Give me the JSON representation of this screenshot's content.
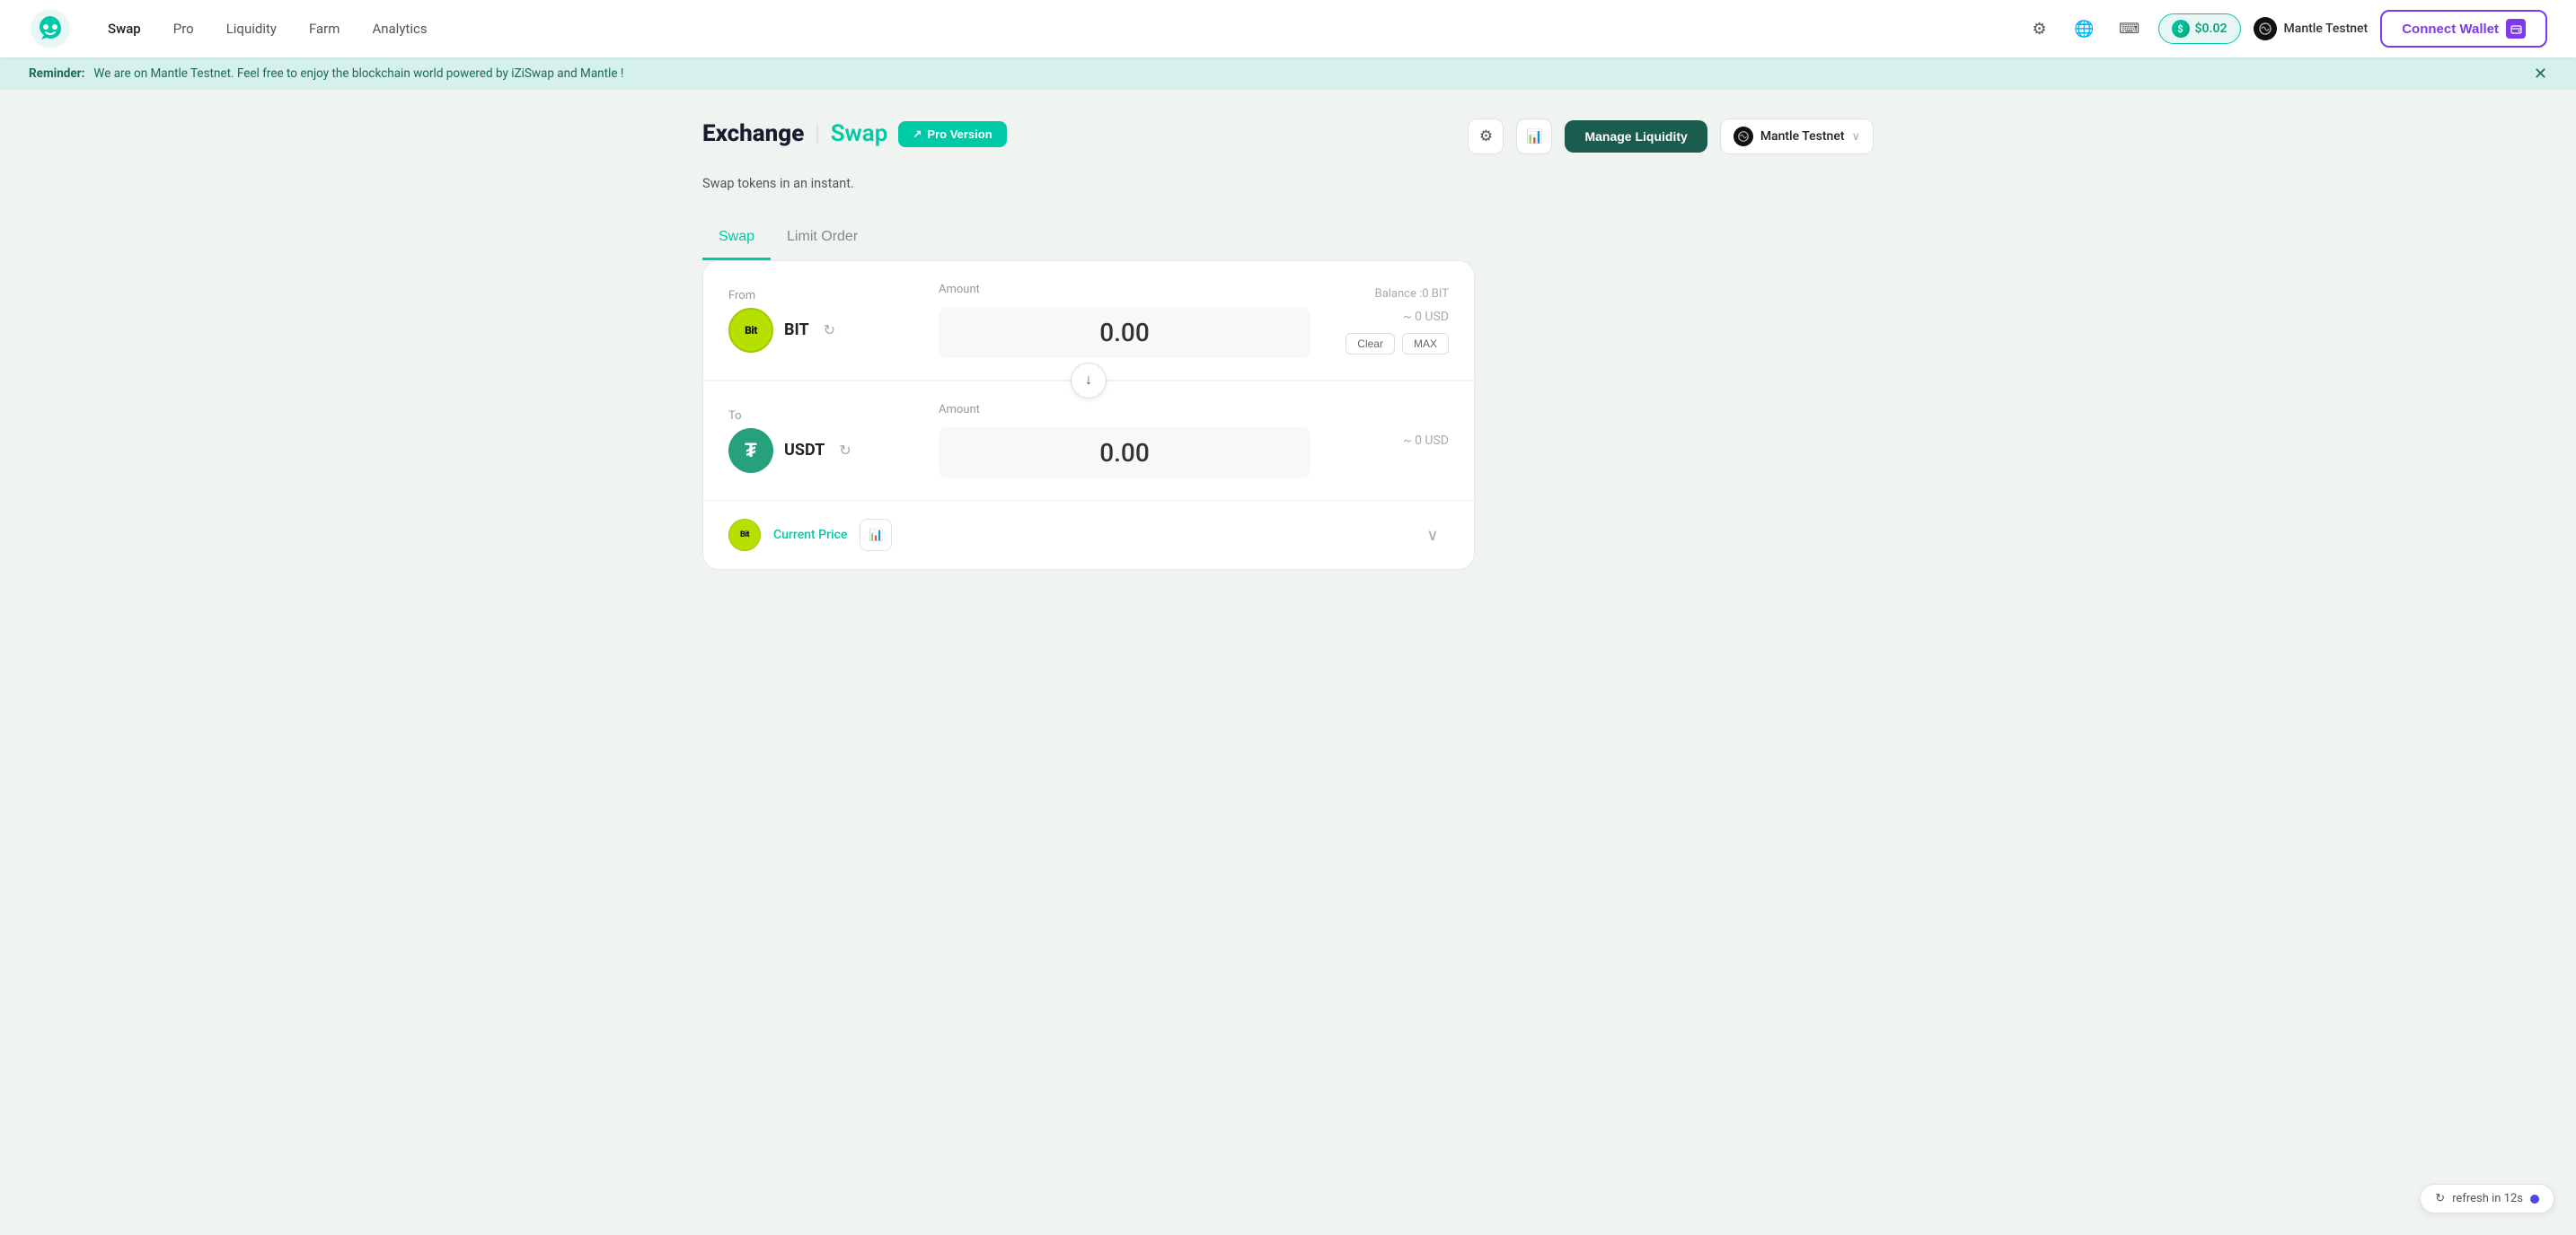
{
  "app": {
    "logo_alt": "iZiSwap Logo"
  },
  "nav": {
    "links": [
      {
        "id": "swap",
        "label": "Swap",
        "active": true
      },
      {
        "id": "pro",
        "label": "Pro",
        "active": false
      },
      {
        "id": "liquidity",
        "label": "Liquidity",
        "active": false
      },
      {
        "id": "farm",
        "label": "Farm",
        "active": false
      },
      {
        "id": "analytics",
        "label": "Analytics",
        "active": false
      }
    ]
  },
  "header": {
    "price_badge": "$0.02",
    "price_icon": "💰",
    "network_name": "Mantle Testnet",
    "connect_wallet_label": "Connect Wallet",
    "sun_icon": "☀",
    "globe_icon": "🌐",
    "key_icon": "⌨"
  },
  "reminder": {
    "label": "Reminder:",
    "message": "We are on Mantle Testnet. Feel free to enjoy the blockchain world powered by iZiSwap and Mantle !"
  },
  "page": {
    "exchange_title": "Exchange",
    "swap_title": "Swap",
    "pro_version_label": "Pro Version",
    "subtitle": "Swap tokens in an instant.",
    "manage_liquidity_label": "Manage Liquidity",
    "network_name": "Mantle Testnet"
  },
  "swap_tabs": [
    {
      "id": "swap",
      "label": "Swap",
      "active": true
    },
    {
      "id": "limit-order",
      "label": "Limit Order",
      "active": false
    }
  ],
  "from_token": {
    "label": "From",
    "token_symbol": "BIT",
    "amount_label": "Amount",
    "amount_value": "0.00",
    "balance_label": "Balance :0 BIT",
    "usd_value": "~ 0 USD",
    "clear_label": "Clear",
    "max_label": "MAX"
  },
  "to_token": {
    "label": "To",
    "token_symbol": "USDT",
    "amount_label": "Amount",
    "amount_value": "0.00",
    "usd_value": "~ 0 USD"
  },
  "current_price": {
    "label": "Current Price"
  },
  "refresh": {
    "label": "refresh in 12s"
  },
  "icons": {
    "settings": "⚙",
    "chart": "📊",
    "swap_arrow": "↓",
    "chevron_down": "∨",
    "close": "✕",
    "refresh": "↻",
    "external_link": "↗"
  }
}
